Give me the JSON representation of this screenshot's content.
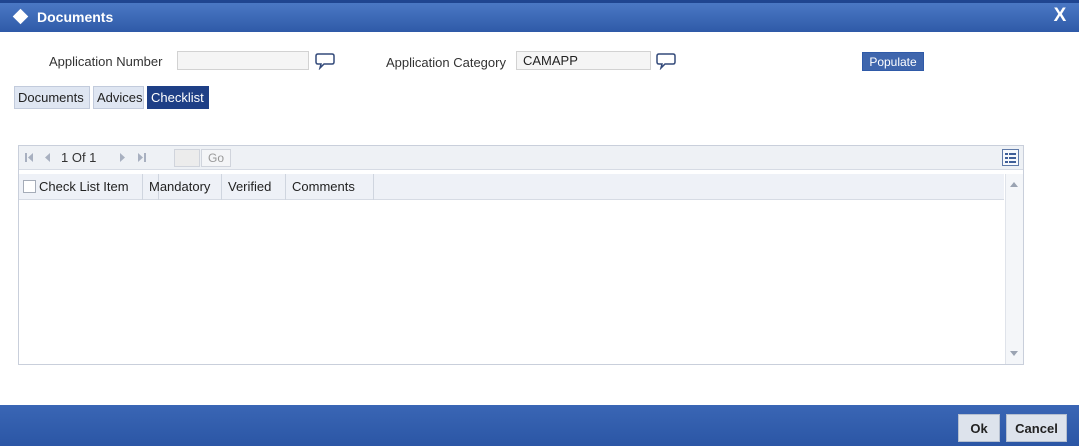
{
  "window": {
    "title": "Documents",
    "close_glyph": "X"
  },
  "form": {
    "application_number_label": "Application Number",
    "application_number_value": "",
    "application_category_label": "Application Category",
    "application_category_value": "CAMAPP",
    "populate_label": "Populate"
  },
  "tabs": [
    {
      "label": "Documents",
      "active": false
    },
    {
      "label": "Advices",
      "active": false
    },
    {
      "label": "Checklist",
      "active": true
    }
  ],
  "grid": {
    "pager_text": "1 Of 1",
    "go_label": "Go",
    "columns": [
      "Check List Item",
      "Mandatory",
      "Verified",
      "Comments"
    ],
    "rows": []
  },
  "footer": {
    "ok_label": "Ok",
    "cancel_label": "Cancel"
  },
  "icons": {
    "lov": "speech-bubble-icon",
    "nav_first": "first-page-icon",
    "nav_prev": "prev-page-icon",
    "nav_next": "next-page-icon",
    "nav_last": "last-page-icon",
    "settings": "list-settings-icon"
  },
  "colors": {
    "titlebar": "#2f5aa8",
    "active_tab": "#1e3f86",
    "populate_button": "#3f66ad",
    "footer": "#2b56a5"
  }
}
